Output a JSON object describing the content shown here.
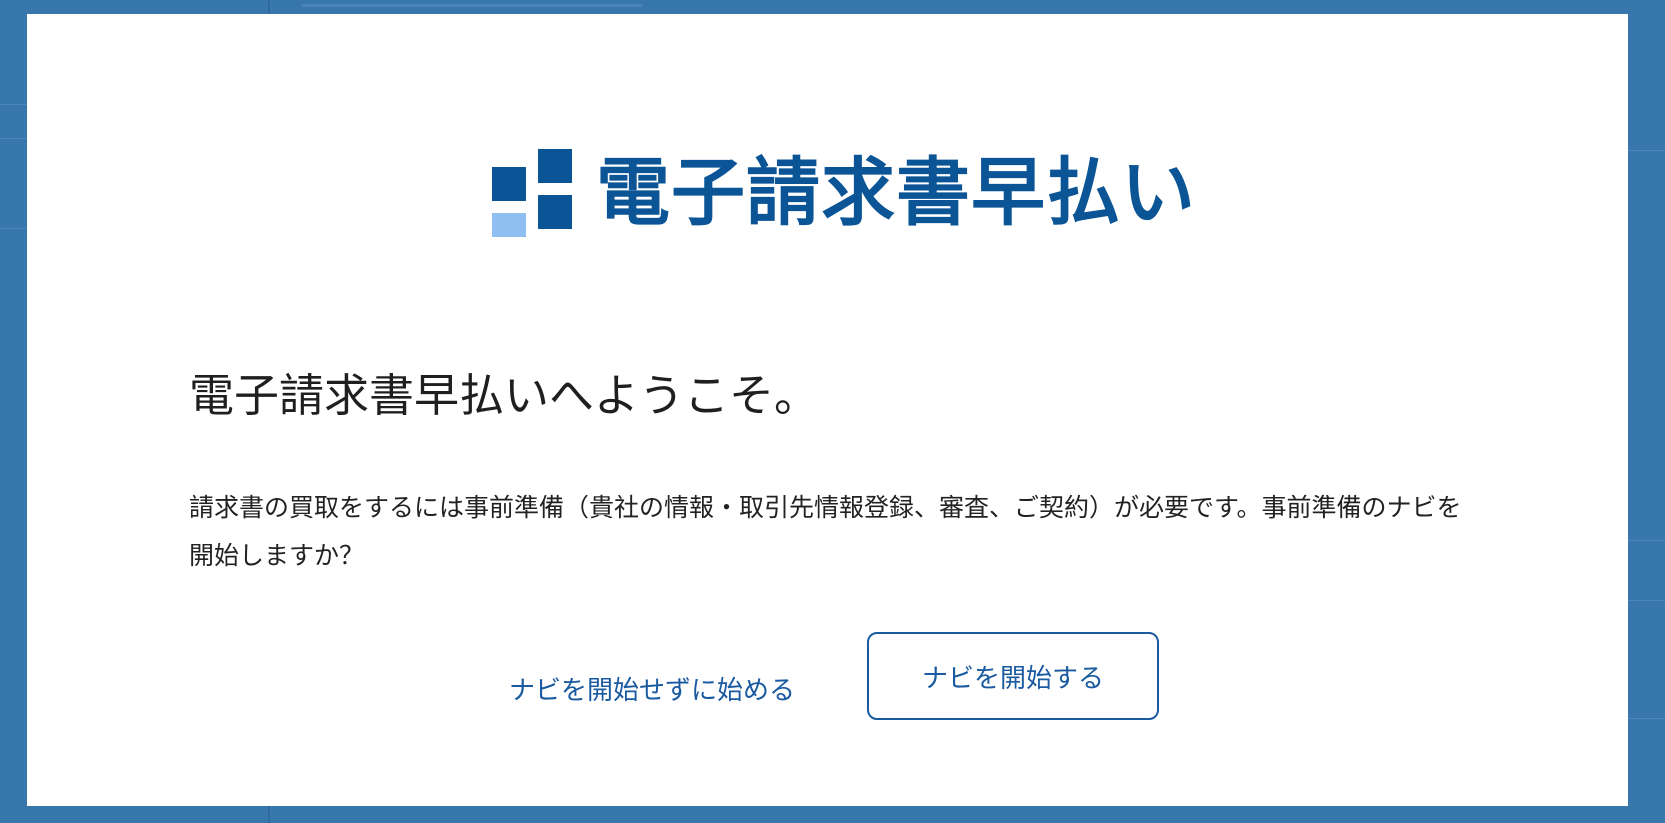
{
  "colors": {
    "backdrop": "#3777ab",
    "brand_blue": "#0b5496",
    "brand_light_blue": "#8fbff2",
    "link_blue": "#1a5aa0"
  },
  "logo": {
    "icon": "logo-squares-icon",
    "text": "電子請求書早払い"
  },
  "dialog": {
    "title": "電子請求書早払いへようこそ。",
    "body": "請求書の買取をするには事前準備（貴社の情報・取引先情報登録、審査、ご契約）が必要です。事前準備のナビを開始しますか？",
    "skip_button_label": "ナビを開始せずに始める",
    "start_button_label": "ナビを開始する"
  }
}
